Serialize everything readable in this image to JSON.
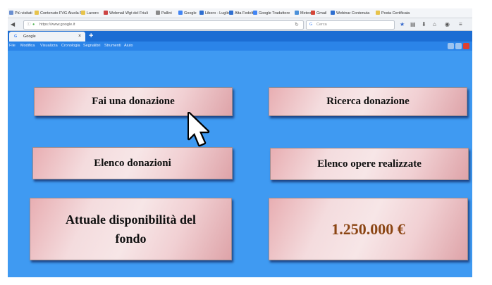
{
  "browser": {
    "bookmarks": [
      {
        "label": "Più visitati",
        "color": "#6a8fd0"
      },
      {
        "label": "Contenuto FVG Aiuola F...",
        "color": "#e7c34b"
      },
      {
        "label": "Lavoro",
        "color": "#e7c34b"
      },
      {
        "label": "Webmail Wgt del Friuli",
        "color": "#cc4444"
      },
      {
        "label": "Pallini",
        "color": "#8a8a8a"
      },
      {
        "label": "Google",
        "color": "#4285f4"
      },
      {
        "label": "Libero - Luglio",
        "color": "#2f6fd0"
      },
      {
        "label": "Alta Fedeltà",
        "color": "#2f6fd0"
      },
      {
        "label": "Google Traduttore",
        "color": "#4285f4"
      },
      {
        "label": "Meteo",
        "color": "#4a90d9"
      },
      {
        "label": "Gmail",
        "color": "#d44638"
      },
      {
        "label": "Webinar Contenuta",
        "color": "#2f6fd0"
      },
      {
        "label": "Posta Certificata",
        "color": "#e7c34b"
      }
    ],
    "url": "https://www.google.it",
    "search_placeholder": "Cerca",
    "tab_title": "Google",
    "tab_close": "×",
    "new_tab": "+",
    "menu": [
      "File",
      "Modifica",
      "Visualizza",
      "Cronologia",
      "Segnalibri",
      "Strumenti",
      "Aiuto"
    ]
  },
  "colors": {
    "background": "#3f9af2",
    "amount": "#8b4513"
  },
  "main": {
    "btn_donate": "Fai una donazione",
    "btn_search": "Ricerca donazione",
    "btn_list": "Elenco donazioni",
    "btn_works": "Elenco opere realizzate",
    "fund_label": "Attuale disponibilità  del fondo",
    "fund_amount": "1.250.000 €"
  }
}
